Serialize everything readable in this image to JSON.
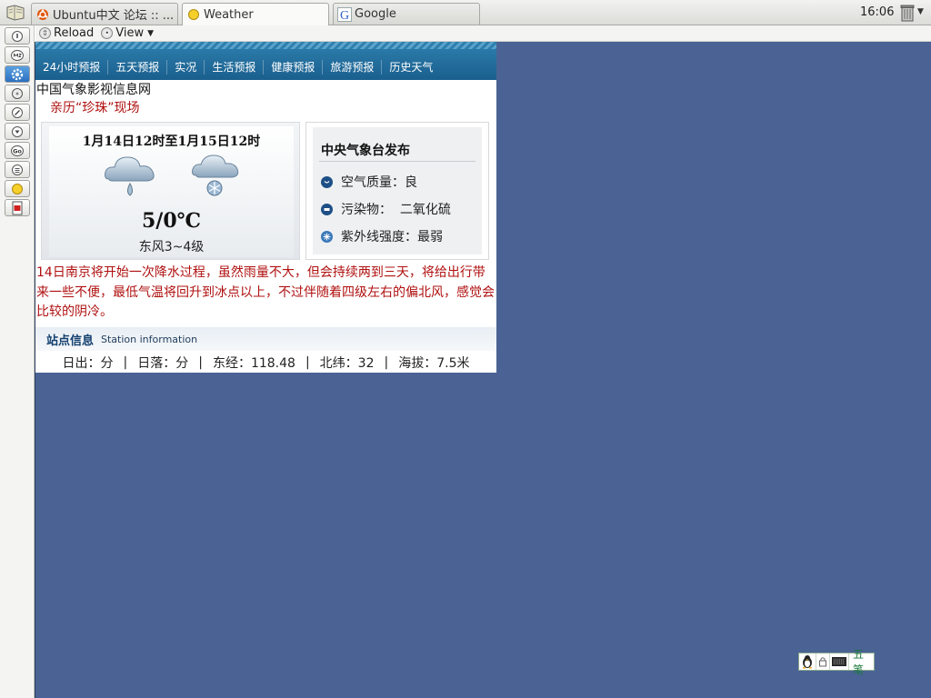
{
  "tabbar": {
    "tabs": [
      {
        "label": "Ubuntu中文 论坛 :: ...",
        "icon": "ubuntu-logo-icon",
        "active": false
      },
      {
        "label": "Weather",
        "icon": "weather-sun-icon",
        "active": true
      },
      {
        "label": "Google",
        "icon": "google-g-icon",
        "active": false
      }
    ],
    "clock": "16:06"
  },
  "navbar": {
    "reload_label": "Reload",
    "view_label": "View",
    "view_arrow": "▼"
  },
  "weather_nav": {
    "items": [
      "24小时预报",
      "五天预报",
      "实况",
      "生活预报",
      "健康预报",
      "旅游预报",
      "历史天气"
    ]
  },
  "site": {
    "name": "中国气象影视信息网",
    "promo": "亲历“珍珠”现场"
  },
  "forecast": {
    "period": "1月14日12时至1月15日12时",
    "temperature": "5/0℃",
    "wind": "东风3~4级"
  },
  "aqi": {
    "title": "中央气象台发布",
    "rows": [
      {
        "label": "空气质量：良",
        "icon": "air-quality-icon"
      },
      {
        "label": "污染物：  二氧化硫",
        "icon": "pollutant-icon"
      },
      {
        "label": "紫外线强度：最弱",
        "icon": "uv-icon"
      }
    ]
  },
  "description": "14日南京将开始一次降水过程，虽然雨量不大，但会持续两到三天，将给出行带来一些不便，最低气温将回升到冰点以上，不过伴随着四级左右的偏北风，感觉会比较的阴冷。",
  "station": {
    "title": "站点信息",
    "subtitle": "Station information",
    "sunrise": "日出：分",
    "sunset": "日落：分",
    "longitude": "东经：118.48",
    "latitude": "北纬：32",
    "altitude": "海拔：7.5米",
    "separator": "|"
  },
  "ime": {
    "label": "五笔"
  },
  "colors": {
    "desktop_bg": "#4a6394",
    "nav_blue": "#1a5f8e",
    "alert_red": "#b01010"
  }
}
